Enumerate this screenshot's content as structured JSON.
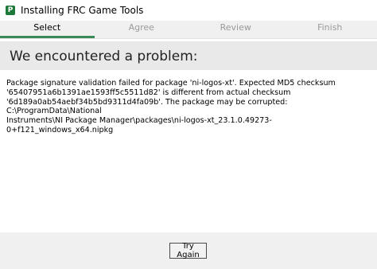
{
  "window": {
    "title": "Installing FRC Game Tools",
    "icon_glyph": "P",
    "accent_color": "#3a8a57"
  },
  "steps": [
    {
      "label": "Select",
      "active": true
    },
    {
      "label": "Agree",
      "active": false
    },
    {
      "label": "Review",
      "active": false
    },
    {
      "label": "Finish",
      "active": false
    }
  ],
  "error": {
    "heading": "We encountered a problem:",
    "message": "Package signature validation failed for package 'ni-logos-xt'. Expected MD5 checksum\n'65407951a6b1391ae1593ff5c5511d82' is different from actual checksum\n'6d189a0ab54aebf34b5bd9311d4fa09b'. The package may be corrupted: C:\\ProgramData\\National\nInstruments\\NI Package Manager\\packages\\ni-logos-xt_23.1.0.49273-0+f121_windows_x64.nipkg"
  },
  "footer": {
    "try_again_label": "Try Again"
  }
}
